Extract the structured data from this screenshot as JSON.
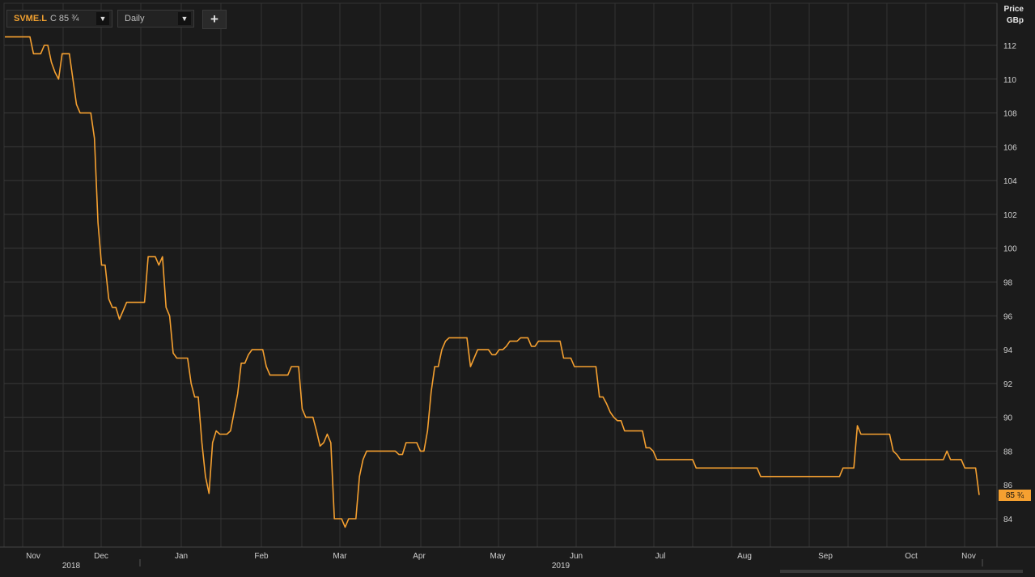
{
  "toolbar": {
    "symbol": "SVME.L",
    "close_prefix": "C",
    "close_value": "85 ¾",
    "interval": "Daily",
    "add_label": "+"
  },
  "axis": {
    "y_title_line1": "Price",
    "y_title_line2": "GBp",
    "last_price_badge": "85 ¾"
  },
  "colors": {
    "background": "#1b1b1b",
    "line": "#f5a030",
    "grid": "#3a3a3a"
  },
  "chart_data": {
    "type": "line",
    "ylim": [
      83,
      113
    ],
    "yticks": [
      84,
      86,
      88,
      90,
      92,
      94,
      96,
      98,
      100,
      102,
      104,
      106,
      108,
      110,
      112
    ],
    "x_month_labels": [
      "Nov",
      "Dec",
      "Jan",
      "Feb",
      "Mar",
      "Apr",
      "May",
      "Jun",
      "Jul",
      "Aug",
      "Sep",
      "Oct",
      "Nov"
    ],
    "x_year_labels": [
      "2018",
      "2019"
    ],
    "grid": true,
    "series": [
      {
        "values": [
          112.5,
          112.5,
          112.5,
          112.5,
          112.5,
          112.5,
          112.5,
          112.5,
          111.5,
          111.5,
          111.5,
          112,
          112,
          111,
          110.4,
          110,
          111.5,
          111.5,
          111.5,
          110,
          108.5,
          108,
          108,
          108,
          108,
          106.5,
          101.5,
          99,
          99,
          97,
          96.5,
          96.5,
          95.8,
          96.3,
          96.8,
          96.8,
          96.8,
          96.8,
          96.8,
          96.8,
          99.5,
          99.5,
          99.5,
          99,
          99.5,
          96.5,
          96,
          93.8,
          93.5,
          93.5,
          93.5,
          93.5,
          92,
          91.2,
          91.2,
          88.5,
          86.5,
          85.5,
          88.5,
          89.2,
          89,
          89,
          89,
          89.2,
          90.3,
          91.4,
          93.2,
          93.2,
          93.7,
          94,
          94,
          94,
          94,
          93,
          92.5,
          92.5,
          92.5,
          92.5,
          92.5,
          92.5,
          93,
          93,
          93,
          90.5,
          90,
          90,
          90,
          89.2,
          88.3,
          88.5,
          89,
          88.5,
          84,
          84,
          84,
          83.5,
          84,
          84,
          84,
          86.5,
          87.5,
          88,
          88,
          88,
          88,
          88,
          88,
          88,
          88,
          88,
          87.8,
          87.8,
          88.5,
          88.5,
          88.5,
          88.5,
          88,
          88,
          89.2,
          91.5,
          93,
          93,
          94,
          94.5,
          94.7,
          94.7,
          94.7,
          94.7,
          94.7,
          94.7,
          93,
          93.5,
          94,
          94,
          94,
          94,
          93.7,
          93.7,
          94,
          94,
          94.2,
          94.5,
          94.5,
          94.5,
          94.7,
          94.7,
          94.7,
          94.2,
          94.2,
          94.5,
          94.5,
          94.5,
          94.5,
          94.5,
          94.5,
          94.5,
          93.5,
          93.5,
          93.5,
          93,
          93,
          93,
          93,
          93,
          93,
          93,
          91.2,
          91.2,
          90.8,
          90.3,
          90,
          89.8,
          89.8,
          89.2,
          89.2,
          89.2,
          89.2,
          89.2,
          89.2,
          88.2,
          88.2,
          88,
          87.5,
          87.5,
          87.5,
          87.5,
          87.5,
          87.5,
          87.5,
          87.5,
          87.5,
          87.5,
          87.5,
          87,
          87,
          87,
          87,
          87,
          87,
          87,
          87,
          87,
          87,
          87,
          87,
          87,
          87,
          87,
          87,
          87,
          87,
          86.5,
          86.5,
          86.5,
          86.5,
          86.5,
          86.5,
          86.5,
          86.5,
          86.5,
          86.5,
          86.5,
          86.5,
          86.5,
          86.5,
          86.5,
          86.5,
          86.5,
          86.5,
          86.5,
          86.5,
          86.5,
          86.5,
          86.5,
          87,
          87,
          87,
          87,
          89.5,
          89,
          89,
          89,
          89,
          89,
          89,
          89,
          89,
          89,
          88,
          87.8,
          87.5,
          87.5,
          87.5,
          87.5,
          87.5,
          87.5,
          87.5,
          87.5,
          87.5,
          87.5,
          87.5,
          87.5,
          87.5,
          88,
          87.5,
          87.5,
          87.5,
          87.5,
          87,
          87,
          87,
          87,
          85.4
        ]
      }
    ]
  }
}
